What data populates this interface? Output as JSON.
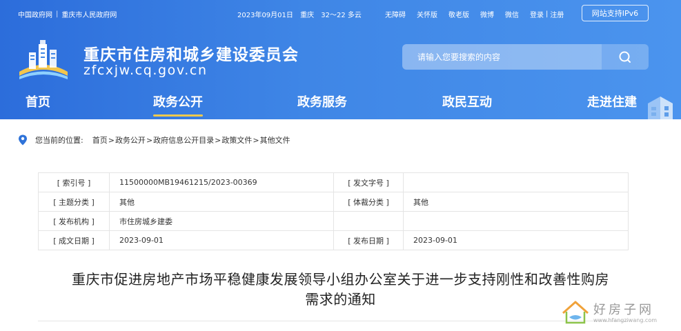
{
  "top_bar": {
    "links": [
      "中国政府网",
      "重庆市人民政府网"
    ],
    "link_separator": "|",
    "date": "2023年09月01日",
    "city": "重庆",
    "weather": "32～22 多云",
    "tools": [
      "无障碍",
      "关怀版",
      "敬老版",
      "微博",
      "微信"
    ],
    "login": "登录",
    "register": "注册",
    "login_separator": "|",
    "ipv6_button": "网站支持IPv6"
  },
  "header": {
    "site_title": "重庆市住房和城乡建设委员会",
    "domain": "zfcxjw.cq.gov.cn",
    "search_placeholder": "请输入您要搜索的内容"
  },
  "nav": {
    "items": [
      "首页",
      "政务公开",
      "政务服务",
      "政民互动",
      "走进住建"
    ],
    "active": "政务公开"
  },
  "breadcrumb": {
    "label": "您当前的位置:",
    "items": [
      "首页",
      "政务公开",
      "政府信息公开目录",
      "政策文件",
      "其他文件"
    ],
    "separator": ">"
  },
  "meta_table": {
    "rows": [
      {
        "k1": "[ 索引号 ]",
        "v1": "11500000MB19461215/2023-00369",
        "k2": "[ 发文字号 ]",
        "v2": ""
      },
      {
        "k1": "[ 主题分类 ]",
        "v1": "其他",
        "k2": "[ 体裁分类 ]",
        "v2": "其他"
      },
      {
        "k1": "[ 发布机构 ]",
        "v1": "市住房城乡建委",
        "k2": "",
        "v2": ""
      },
      {
        "k1": "[ 成文日期 ]",
        "v1": "2023-09-01",
        "k2": "[ 发布日期 ]",
        "v2": "2023-09-01"
      }
    ]
  },
  "document": {
    "title_line1": "重庆市促进房地产市场平稳健康发展领导小组办公室关于进一步支持刚性和改善性购房",
    "title_line2": "需求的通知"
  },
  "watermark": {
    "name": "好房子网",
    "url": "www.hfangziwang.com"
  },
  "colors": {
    "header_blue": "#3f86e6",
    "nav_active_underline": "#f2c94c",
    "table_border": "#e4e4e4"
  }
}
